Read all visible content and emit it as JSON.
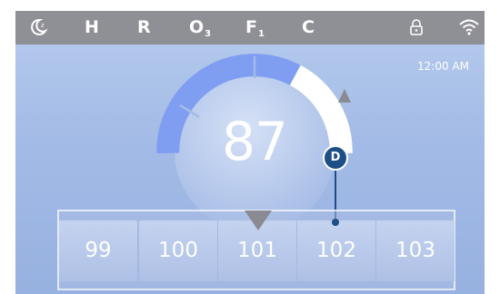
{
  "status_bar": {
    "items": [
      {
        "label": "H"
      },
      {
        "label": "R"
      },
      {
        "label": "O",
        "sub": "3"
      },
      {
        "label": "F",
        "sub": "1"
      },
      {
        "label": "C"
      }
    ],
    "icons": [
      "moon-icon",
      "lock-icon",
      "wifi-icon"
    ]
  },
  "clock": "12:00 AM",
  "set_temperature": 87,
  "callout_label": "D",
  "picker": {
    "values": [
      "99",
      "100",
      "101",
      "102",
      "103"
    ],
    "selected": "101"
  },
  "colors": {
    "status_bar": "#8f8f96",
    "screen_top": "#b7cced",
    "screen_bottom": "#97b1e0",
    "gauge_fill": "#7f9ef2",
    "gauge_track": "#ffffff",
    "callout": "#1d4f86"
  }
}
